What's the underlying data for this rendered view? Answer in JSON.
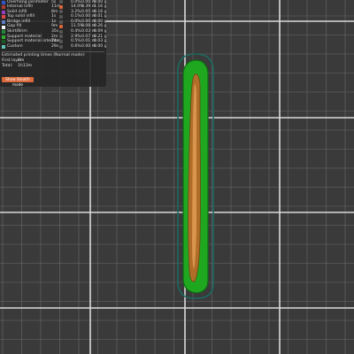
{
  "legend": {
    "rows": [
      {
        "name": "Overhang perimeter",
        "time": "5s",
        "pct": "0.0%",
        "length": "0.00 m",
        "weight": "0.00 g",
        "color": "#3355cc",
        "visible": false
      },
      {
        "name": "Internal infill",
        "time": "11m",
        "pct": "14.0%",
        "length": "0.39 m",
        "weight": "1.16 g",
        "color": "#b03a2e",
        "visible": true
      },
      {
        "name": "Solid infill",
        "time": "8m",
        "pct": "3.2%",
        "length": "0.05 m",
        "weight": "0.16 g",
        "color": "#9a3cc0",
        "visible": false
      },
      {
        "name": "Top solid infill",
        "time": "1s",
        "pct": "0.1%",
        "length": "0.00 m",
        "weight": "0.01 g",
        "color": "#e04848",
        "visible": false
      },
      {
        "name": "Bridge infill",
        "time": "1s",
        "pct": "0.0%",
        "length": "0.00 m",
        "weight": "0.00 g",
        "color": "#5a7cc0",
        "visible": false
      },
      {
        "name": "Gap fill",
        "time": "9m",
        "pct": "11.5%",
        "length": "0.08 m",
        "weight": "0.26 g",
        "color": "#f2f2f2",
        "visible": true
      },
      {
        "name": "Skirt/Brim",
        "time": "35s",
        "pct": "0.4%",
        "length": "0.03 m",
        "weight": "0.09 g",
        "color": "#1f8a3a",
        "visible": false
      },
      {
        "name": "Support material",
        "time": "2m",
        "pct": "2.9%",
        "length": "0.07 m",
        "weight": "0.21 g",
        "color": "#2ab02a",
        "visible": false
      },
      {
        "name": "Support material interface",
        "time": "24s",
        "pct": "0.5%",
        "length": "0.01 m",
        "weight": "0.03 g",
        "color": "#1a5a20",
        "visible": false
      },
      {
        "name": "Custom",
        "time": "29s",
        "pct": "0.6%",
        "length": "0.00 m",
        "weight": "0.00 g",
        "color": "#5ec5b5",
        "visible": false
      }
    ],
    "estimate_title": "Estimated printing times (Normal mode):",
    "first_layer_label": "First layer:",
    "first_layer_value": "2m",
    "total_label": "Total:",
    "total_value": "1h13m",
    "mode_button": "Show Stealth mode"
  },
  "colors": {
    "bed": "#3a3a3a",
    "grid_minor": "#6a6a6a",
    "grid_major": "#dadada",
    "support": "#1fa81f",
    "support_edge": "#0f6a14",
    "skirt": "#1d6a60",
    "perimeter": "#b06d28",
    "infill": "#d9954d"
  }
}
